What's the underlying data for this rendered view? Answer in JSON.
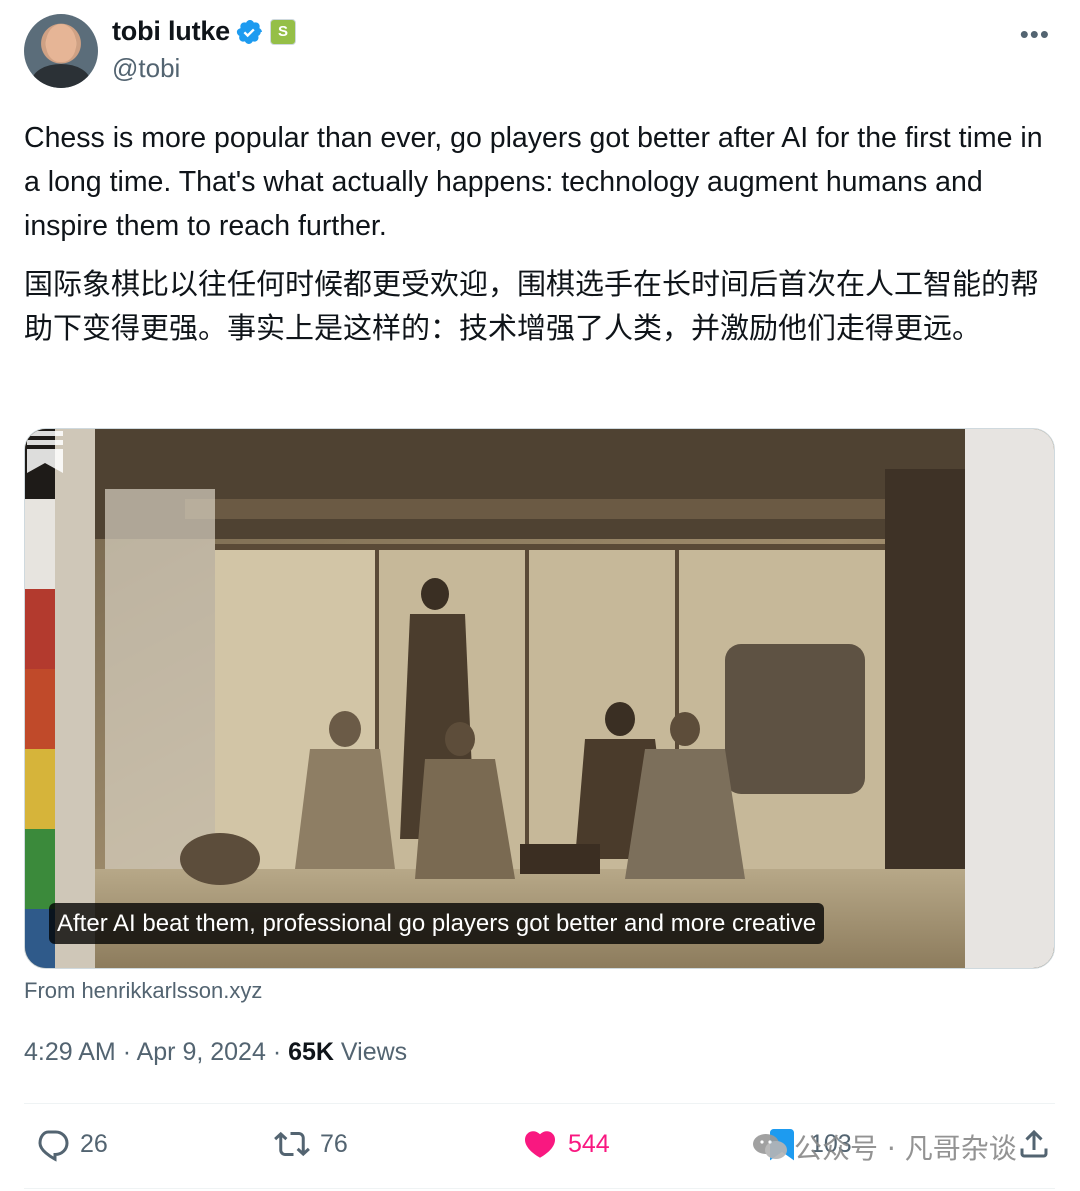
{
  "author": {
    "display_name": "tobi lutke",
    "handle": "@tobi",
    "verified_icon": "verified-badge-icon",
    "affiliate_icon": "shopify-badge-icon",
    "affiliate_glyph": "S"
  },
  "tweet": {
    "text_en": "Chess is more popular than ever, go players got better after AI for the first time in a long time. That's what actually happens: technology augment humans and inspire them to reach further.",
    "text_zh": "国际象棋比以往任何时候都更受欢迎，围棋选手在长时间后首次在人工智能的帮助下变得更强。事实上是这样的：技术增强了人类，并激励他们走得更远。"
  },
  "card": {
    "caption": "After AI beat them, professional go players got better and more creative",
    "source": "From henrikkarlsson.xyz"
  },
  "meta": {
    "time": "4:29 AM",
    "separator": "·",
    "date": "Apr 9, 2024",
    "views_count": "65K",
    "views_label": "Views"
  },
  "actions": {
    "replies": "26",
    "reposts": "76",
    "likes": "544",
    "bookmarks": "103"
  },
  "watermark": {
    "text": "公众号 · 凡哥杂谈"
  },
  "colors": {
    "text": "#0f1419",
    "secondary": "#536471",
    "like": "#f91880",
    "verified": "#1d9bf0"
  }
}
